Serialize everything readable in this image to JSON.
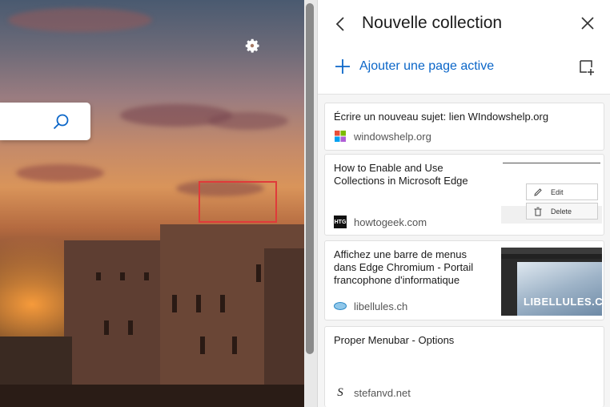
{
  "newtab": {
    "settings_icon": "gear-icon",
    "search_icon": "search-icon"
  },
  "panel": {
    "title": "Nouvelle collection",
    "add_label": "Ajouter une page active",
    "icons": [
      "back-arrow-icon",
      "close-icon",
      "plus-icon",
      "add-note-icon"
    ],
    "accent_color": "#0b66c8"
  },
  "items": [
    {
      "title": "Écrire un nouveau sujet: lien WIndowshelp.org",
      "site": "windowshelp.org",
      "favicon": "windows-logo-icon"
    },
    {
      "title_lines": [
        "How to Enable and Use",
        "Collections in Microsoft Edge"
      ],
      "site": "howtogeek.com",
      "favicon": "htg-icon",
      "favicon_text": "HTG",
      "context_menu": {
        "edit": "Edit",
        "delete": "Delete"
      }
    },
    {
      "title_lines": [
        "Affichez une barre de menus",
        "dans Edge Chromium - Portail",
        "francophone d'informatique"
      ],
      "site": "libellules.ch",
      "favicon": "libellules-icon",
      "thumb_text": "LIBELLULES.C"
    },
    {
      "title": "Proper Menubar - Options",
      "site": "stefanvd.net",
      "favicon": "stefanvd-icon",
      "favicon_text": "S"
    }
  ]
}
